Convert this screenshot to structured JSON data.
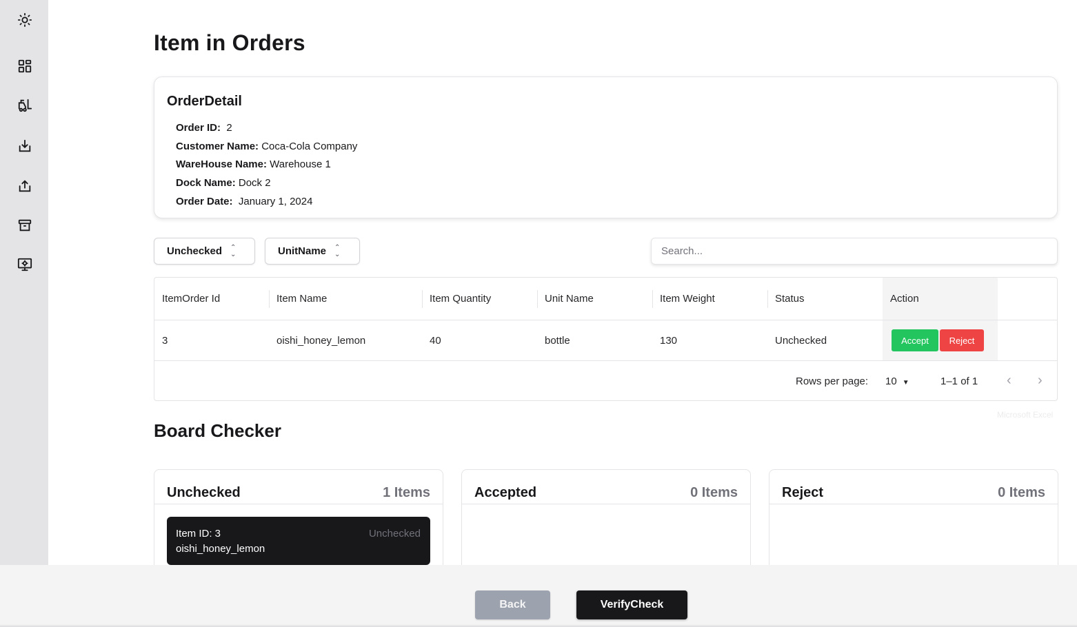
{
  "sidebar": {
    "icons": [
      "sun-icon",
      "dashboard-icon",
      "forklift-icon",
      "inbound-icon",
      "outbound-icon",
      "archive-icon",
      "monitor-settings-icon"
    ]
  },
  "page": {
    "title": "Item in Orders"
  },
  "order_detail": {
    "title": "OrderDetail",
    "order_id_label": "Order ID:",
    "order_id": "2",
    "customer_label": "Customer Name:",
    "customer": "Coca-Cola Company",
    "warehouse_label": "WareHouse Name:",
    "warehouse": "Warehouse 1",
    "dock_label": "Dock Name:",
    "dock": "Dock 2",
    "date_label": "Order Date:",
    "date": "January 1, 2024"
  },
  "filters": {
    "status_select": "Unchecked",
    "unit_select": "UnitName",
    "search_placeholder": "Search..."
  },
  "table": {
    "headers": [
      "ItemOrder Id",
      "Item Name",
      "Item Quantity",
      "Unit Name",
      "Item Weight",
      "Status",
      "Action"
    ],
    "rows": [
      {
        "id": "3",
        "name": "oishi_honey_lemon",
        "quantity": "40",
        "unit": "bottle",
        "weight": "130",
        "status": "Unchecked"
      }
    ],
    "accept_label": "Accept",
    "reject_label": "Reject",
    "footer": {
      "rows_per_page_label": "Rows per page:",
      "rows_per_page": "10",
      "range": "1–1 of 1"
    }
  },
  "watermark": "Microsoft Excel",
  "board": {
    "title": "Board Checker",
    "columns": [
      {
        "title": "Unchecked",
        "count": "1 Items"
      },
      {
        "title": "Accepted",
        "count": "0 Items"
      },
      {
        "title": "Reject",
        "count": "0 Items"
      }
    ],
    "card": {
      "id_text": "Item ID: 3",
      "name": "oishi_honey_lemon",
      "status": "Unchecked"
    }
  },
  "actions": {
    "back": "Back",
    "verify": "VerifyCheck"
  },
  "colors": {
    "accent_dark": "#18181b",
    "accept_green": "#22c55e",
    "reject_red": "#ef4444",
    "back_gray": "#9ca3af"
  }
}
